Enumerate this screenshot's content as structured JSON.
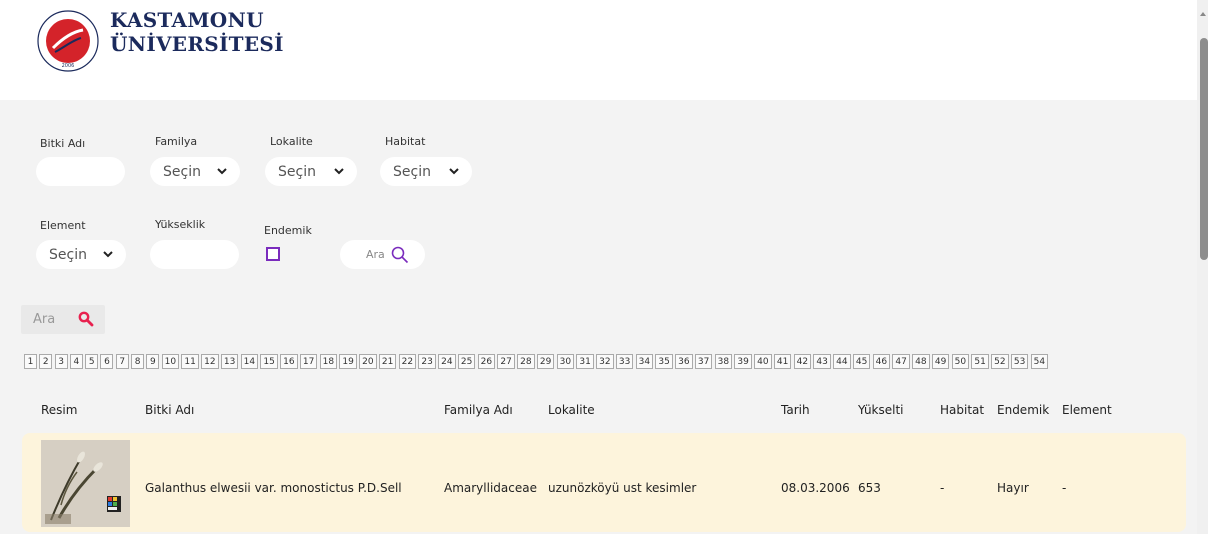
{
  "header": {
    "brand_line1": "KASTAMONU",
    "brand_line2": "ÜNİVERSİTESİ",
    "logo_year": "2006",
    "logo_arc_text": "KASTAMONU ÜNİVERSİTESİ"
  },
  "filters": {
    "bitki_adi_label": "Bitki Adı",
    "familya_label": "Familya",
    "lokalite_label": "Lokalite",
    "habitat_label": "Habitat",
    "element_label": "Element",
    "yukseklik_label": "Yükseklik",
    "endemik_label": "Endemik",
    "familya_value": "Seçin",
    "lokalite_value": "Seçin",
    "habitat_value": "Seçin",
    "element_value": "Seçin",
    "ara_button": "Ara",
    "endemik_checked": false
  },
  "search": {
    "placeholder": "Ara"
  },
  "pagination": {
    "pages": [
      "1",
      "2",
      "3",
      "4",
      "5",
      "6",
      "7",
      "8",
      "9",
      "10",
      "11",
      "12",
      "13",
      "14",
      "15",
      "16",
      "17",
      "18",
      "19",
      "20",
      "21",
      "22",
      "23",
      "24",
      "25",
      "26",
      "27",
      "28",
      "29",
      "30",
      "31",
      "32",
      "33",
      "34",
      "35",
      "36",
      "37",
      "38",
      "39",
      "40",
      "41",
      "42",
      "43",
      "44",
      "45",
      "46",
      "47",
      "48",
      "49",
      "50",
      "51",
      "52",
      "53",
      "54"
    ]
  },
  "table": {
    "columns": {
      "resim": "Resim",
      "bitki_adi": "Bitki Adı",
      "familya_adi": "Familya Adı",
      "lokalite": "Lokalite",
      "tarih": "Tarih",
      "yukselti": "Yükselti",
      "habitat": "Habitat",
      "endemik": "Endemik",
      "element": "Element"
    },
    "rows": [
      {
        "bitki_adi": "Galanthus elwesii var. monostictus P.D.Sell",
        "familya_adi": "Amaryllidaceae",
        "lokalite": "uzunözköyü ust kesimler",
        "tarih": "08.03.2006",
        "yukselti": "653",
        "habitat": "-",
        "endemik": "Hayır",
        "element": "-"
      }
    ]
  },
  "colors": {
    "brand_navy": "#1b2a5c",
    "logo_red": "#d4232a",
    "search_icon": "#e8214f",
    "ara_icon": "#7a2bbd",
    "row_bg": "#fdf4dc"
  }
}
